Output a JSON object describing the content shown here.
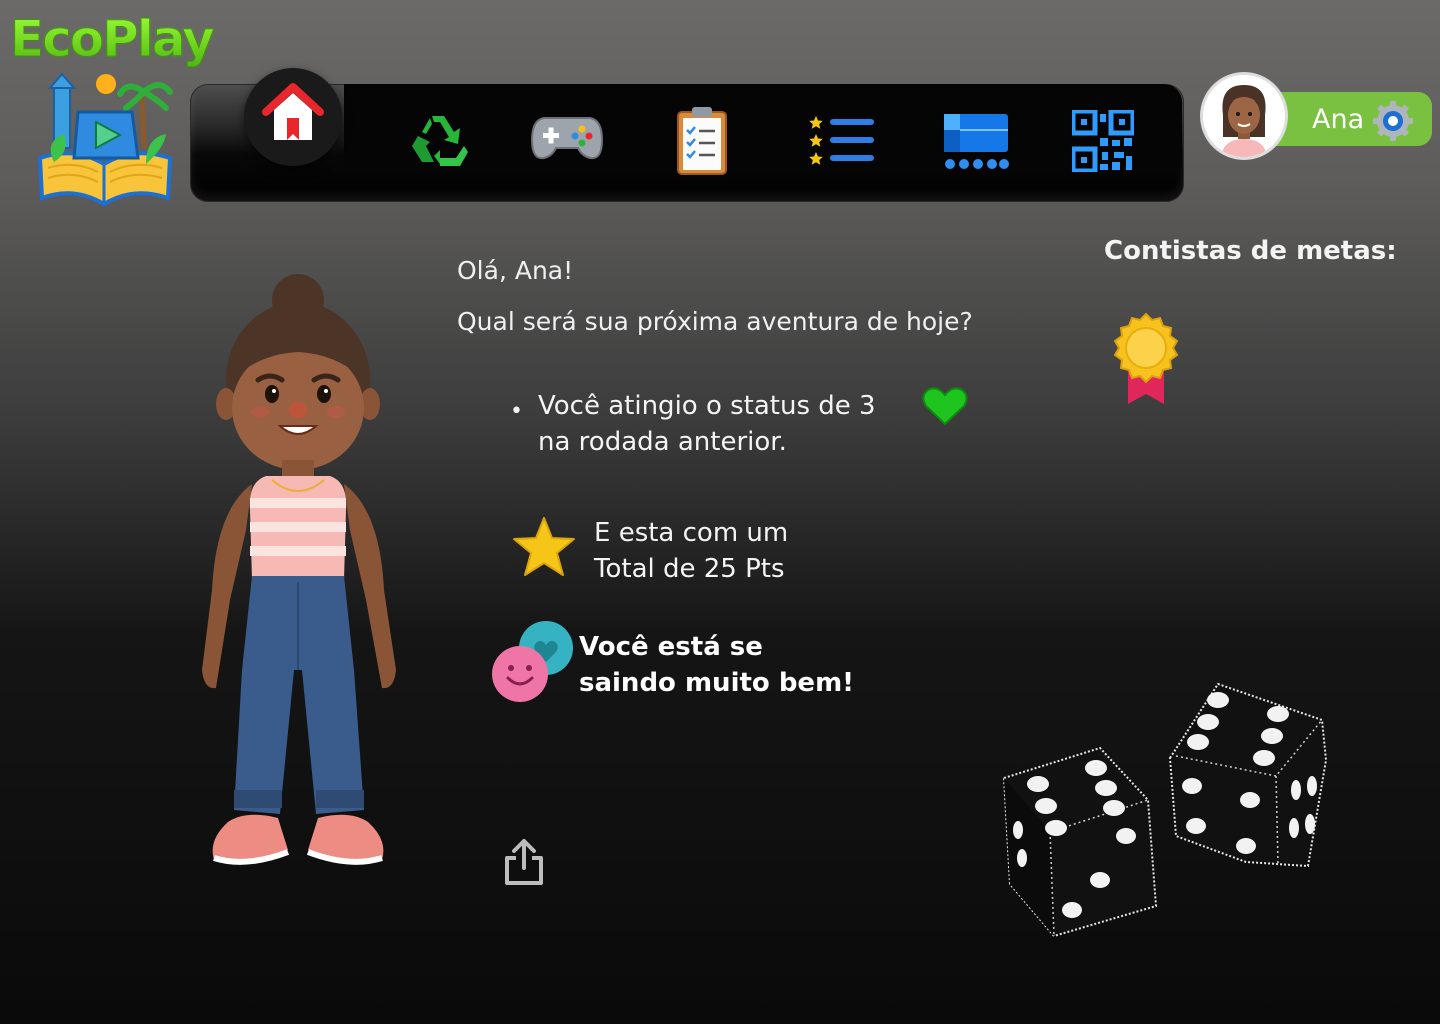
{
  "app": {
    "logo_text": "EcoPlay"
  },
  "nav": {
    "items": [
      {
        "icon": "home-icon",
        "active": true
      },
      {
        "icon": "recycle-icon"
      },
      {
        "icon": "gamepad-icon"
      },
      {
        "icon": "clipboard-checklist-icon"
      },
      {
        "icon": "ranking-list-icon"
      },
      {
        "icon": "dashboard-icon"
      },
      {
        "icon": "qr-code-icon"
      }
    ]
  },
  "profile": {
    "name": "Ana",
    "settings_icon": "gear-icon"
  },
  "main": {
    "greeting": "Olá, Ana!",
    "question": "Qual será sua próxima aventura de hoje?",
    "status_line1": "Você atingio o status de 3",
    "status_line2": "na rodada anterior.",
    "points_line1": "E esta com um",
    "points_line2": "Total de 25 Pts",
    "encourage_line1": "Você está se",
    "encourage_line2": "saindo muito bem!"
  },
  "goals": {
    "title": "Contistas de metas:",
    "badges": [
      "medal-icon"
    ]
  },
  "colors": {
    "accent_green": "#7ac142",
    "heart_green": "#1ec51e",
    "star_yellow": "#f5c518"
  }
}
